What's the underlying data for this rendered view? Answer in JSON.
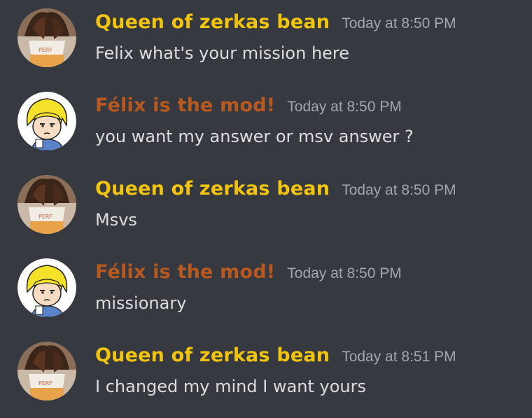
{
  "colors": {
    "background": "#36393f",
    "queen_name": "#f1c40f",
    "felix_name": "#b8591f",
    "timestamp": "#a3a6aa",
    "message_text": "#dcddde"
  },
  "messages": [
    {
      "author": "Queen of zerkas bean",
      "timestamp": "Today at 8:50 PM",
      "text": "Felix what's your mission here",
      "avatar": "coffee-cup-avatar"
    },
    {
      "author": "Félix is the mod!",
      "timestamp": "Today at 8:50 PM",
      "text": "you want my answer or msv answer ?",
      "avatar": "cartoon-boy-avatar"
    },
    {
      "author": "Queen of zerkas bean",
      "timestamp": "Today at 8:50 PM",
      "text": "Msvs",
      "avatar": "coffee-cup-avatar"
    },
    {
      "author": "Félix is the mod!",
      "timestamp": "Today at 8:50 PM",
      "text": "missionary",
      "avatar": "cartoon-boy-avatar"
    },
    {
      "author": "Queen of zerkas bean",
      "timestamp": "Today at 8:51 PM",
      "text": "I changed my mind I want yours",
      "avatar": "coffee-cup-avatar"
    }
  ]
}
